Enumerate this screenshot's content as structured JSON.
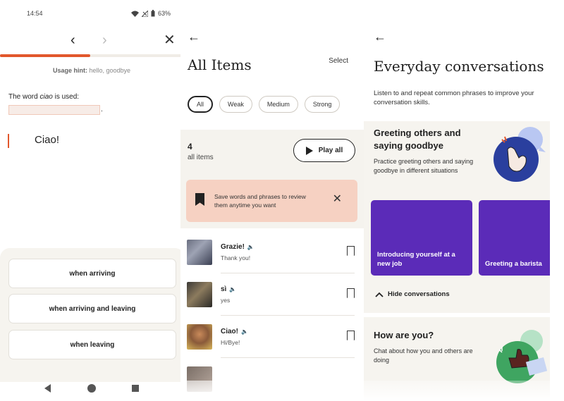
{
  "quiz": {
    "status": {
      "time": "14:54",
      "battery": "63%"
    },
    "nav": {
      "back": "‹",
      "forward": "›",
      "close": "✕"
    },
    "progress": 0.5,
    "hint_label": "Usage hint:",
    "hint_value": "hello, goodbye",
    "question_prefix": "The word ",
    "question_word": "ciao",
    "question_suffix": " is used:",
    "phrase": "Ciao!",
    "answers": [
      "when arriving",
      "when arriving and leaving",
      "when leaving"
    ]
  },
  "items": {
    "back": "←",
    "title": "All Items",
    "select_label": "Select",
    "filters": [
      "All",
      "Weak",
      "Medium",
      "Strong"
    ],
    "count": "4",
    "count_label": "all items",
    "play_all": "Play all",
    "banner_text": "Save words and phrases to review them anytime you want",
    "banner_close": "✕",
    "list": [
      {
        "word": "Grazie!",
        "translation": "Thank you!"
      },
      {
        "word": "sì",
        "translation": "yes"
      },
      {
        "word": "Ciao!",
        "translation": "Hi/Bye!"
      }
    ],
    "speaker_icon": "🔈"
  },
  "conversations": {
    "back": "←",
    "title": "Everyday conversations",
    "intro": "Listen to and repeat common phrases to improve your conversation skills.",
    "section1": {
      "title": "Greeting others and saying goodbye",
      "description": "Practice greeting others and saying goodbye in different situations",
      "cards": [
        "Introducing yourself at a new job",
        "Greeting a barista"
      ],
      "toggle": "Hide conversations"
    },
    "section2": {
      "title": "How are you?",
      "description": "Chat about how you and others are doing"
    }
  },
  "colors": {
    "accent": "#e2572c",
    "card_purple": "#5b2bb8",
    "banner_pink": "#f6d1c2",
    "section_bg": "#f6f4ef"
  }
}
